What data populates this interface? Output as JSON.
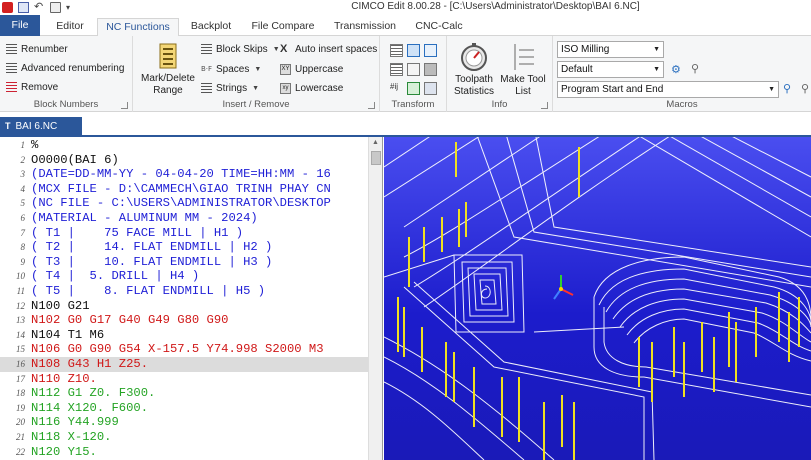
{
  "window": {
    "title": "CIMCO Edit 8.00.28 - [C:\\Users\\Administrator\\Desktop\\BAI 6.NC]"
  },
  "quick_access": [
    "app-logo-icon",
    "save-icon",
    "undo-icon",
    "print-icon",
    "customize-icon"
  ],
  "ribbon_tabs": [
    {
      "label": "File"
    },
    {
      "label": "Editor"
    },
    {
      "label": "NC Functions"
    },
    {
      "label": "Backplot"
    },
    {
      "label": "File Compare"
    },
    {
      "label": "Transmission"
    },
    {
      "label": "CNC-Calc"
    }
  ],
  "active_tab": "NC Functions",
  "ribbon": {
    "block_numbers": {
      "label": "Block Numbers",
      "renumber": "Renumber",
      "advanced": "Advanced renumbering",
      "remove": "Remove"
    },
    "insert_remove": {
      "label": "Insert / Remove",
      "mark_delete_line1": "Mark/Delete",
      "mark_delete_line2": "Range",
      "block_skips": "Block Skips",
      "spaces": "Spaces",
      "strings": "Strings",
      "auto_insert": "Auto insert spaces",
      "uppercase": "Uppercase",
      "lowercase": "Lowercase"
    },
    "transform": {
      "label": "Transform"
    },
    "info": {
      "label": "Info",
      "toolpath_line1": "Toolpath",
      "toolpath_line2": "Statistics",
      "maketool_line1": "Make Tool",
      "maketool_line2": "List"
    },
    "macros": {
      "label": "Macros",
      "machine_select": "ISO Milling",
      "config_select": "Default",
      "macro_select": "Program Start and End"
    }
  },
  "doc_tab": {
    "label": "BAI 6.NC"
  },
  "editor": {
    "lines": [
      {
        "n": "1",
        "text": "%",
        "color": "black"
      },
      {
        "n": "2",
        "text": "O0000(BAI 6)",
        "color": "black"
      },
      {
        "n": "3",
        "text": "(DATE=DD-MM-YY - 04-04-20 TIME=HH:MM - 16",
        "color": "blue"
      },
      {
        "n": "4",
        "text": "(MCX FILE - D:\\CAMMECH\\GIAO TRINH PHAY CN",
        "color": "blue"
      },
      {
        "n": "5",
        "text": "(NC FILE - C:\\USERS\\ADMINISTRATOR\\DESKTOP",
        "color": "blue"
      },
      {
        "n": "6",
        "text": "(MATERIAL - ALUMINUM MM - 2024)",
        "color": "blue"
      },
      {
        "n": "7",
        "text": "( T1 |    75 FACE MILL | H1 )",
        "color": "blue"
      },
      {
        "n": "8",
        "text": "( T2 |    14. FLAT ENDMILL | H2 )",
        "color": "blue"
      },
      {
        "n": "9",
        "text": "( T3 |    10. FLAT ENDMILL | H3 )",
        "color": "blue"
      },
      {
        "n": "10",
        "text": "( T4 |  5. DRILL | H4 )",
        "color": "blue"
      },
      {
        "n": "11",
        "text": "( T5 |    8. FLAT ENDMILL | H5 )",
        "color": "blue"
      },
      {
        "n": "12",
        "text": "N100 G21",
        "color": "black"
      },
      {
        "n": "13",
        "text": "N102 G0 G17 G40 G49 G80 G90",
        "color": "red"
      },
      {
        "n": "14",
        "text": "N104 T1 M6",
        "color": "black"
      },
      {
        "n": "15",
        "text": "N106 G0 G90 G54 X-157.5 Y74.998 S2000 M3",
        "color": "red"
      },
      {
        "n": "16",
        "text": "N108 G43 H1 Z25.",
        "color": "red",
        "highlight": true
      },
      {
        "n": "17",
        "text": "N110 Z10.",
        "color": "red"
      },
      {
        "n": "18",
        "text": "N112 G1 Z0. F300.",
        "color": "green"
      },
      {
        "n": "19",
        "text": "N114 X120. F600.",
        "color": "green"
      },
      {
        "n": "20",
        "text": "N116 Y44.999",
        "color": "green"
      },
      {
        "n": "21",
        "text": "N118 X-120.",
        "color": "green"
      },
      {
        "n": "22",
        "text": "N120 Y15.",
        "color": "green"
      }
    ]
  },
  "colors": {
    "accent": "#2b579a",
    "code_black": "#111111",
    "code_blue": "#1f1fd6",
    "code_red": "#d01818",
    "code_green": "#25a425",
    "viewport_bg": "#2222dd",
    "toolpath_rapid": "#ffffff",
    "toolpath_drill": "#f0e020"
  }
}
